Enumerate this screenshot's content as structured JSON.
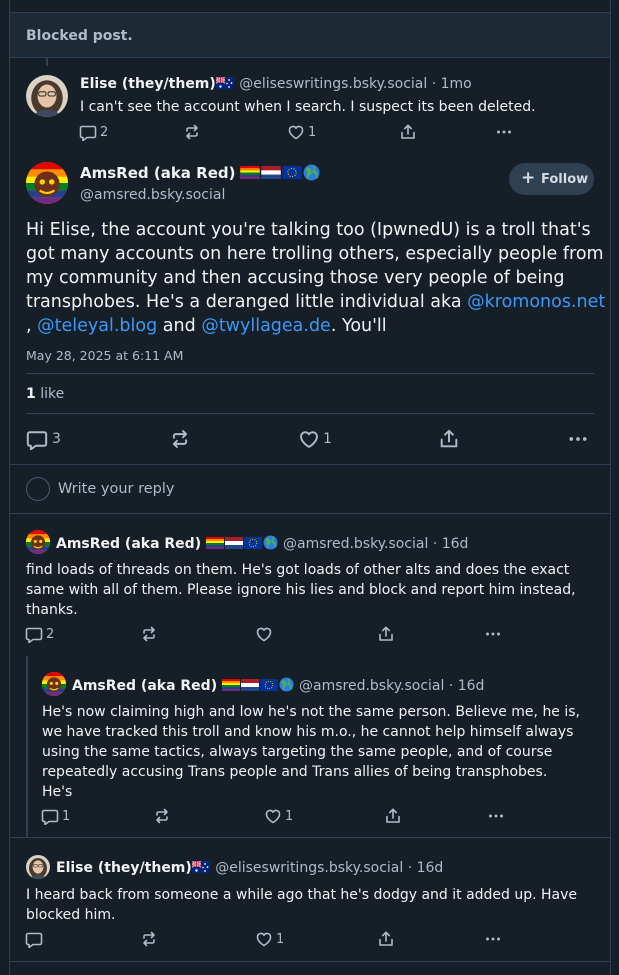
{
  "blocked": {
    "label": "Blocked post."
  },
  "parent": {
    "name": "Elise (they/them)",
    "handle": "@eliseswritings.bsky.social",
    "time": "· 1mo",
    "text": "I can't see the account when I search. I suspect its been deleted.",
    "replies": "2",
    "likes": "1"
  },
  "main": {
    "name": "AmsRed (aka Red)",
    "handle": "@amsred.bsky.social",
    "follow_label": "Follow",
    "text_lines": [
      "Hi Elise, the account you're talking too (IpwnedU) is a troll that's",
      "got many accounts on here trolling others, especially people from",
      "my community and then accusing those very people of being"
    ],
    "text_line4": "transphobes. He's a deranged little individual aka ",
    "mention1": "@kromonos.net",
    "line5_prefix": ",",
    "mention2": "@teleyal.blog",
    "line5_and": "and",
    "mention3": "@twyllagea.de",
    "line5_suffix": ". You'll",
    "date": "May 28, 2025 at 6:11 AM",
    "like_count": "1",
    "like_label": "like",
    "replies": "3",
    "likes": "1"
  },
  "composer": {
    "placeholder": "Write your reply"
  },
  "reply1": {
    "name": "AmsRed (aka Red)",
    "handle": "@amsred.bsky.social",
    "time": "· 16d",
    "lines": [
      "find loads of threads on them. He's got loads of other alts and does the exact",
      "same with all of them. Please ignore his lies and block and report him instead,",
      "thanks."
    ],
    "replies": "2"
  },
  "reply2": {
    "name": "AmsRed (aka Red)",
    "handle": "@amsred.bsky.social",
    "time": "· 16d",
    "lines": [
      "He's now claiming high and low he's not the same person. Believe me, he is,",
      "we have tracked this troll and know his m.o., he cannot help himself always",
      "using the same tactics, always targeting the same people, and of course",
      "repeatedly accusing Trans people and Trans allies of being transphobes.",
      "He's"
    ],
    "replies": "1",
    "likes": "1"
  },
  "reply3": {
    "name": "Elise (they/them)",
    "handle": "@eliseswritings.bsky.social",
    "time": "· 16d",
    "lines": [
      "I heard back from someone a while ago that he's dodgy and it added up. Have",
      "blocked him."
    ],
    "likes": "1"
  },
  "colors": {
    "background": "#161e27",
    "border": "#2e4052",
    "link": "#3b9af8",
    "muted": "#aebbc9"
  }
}
